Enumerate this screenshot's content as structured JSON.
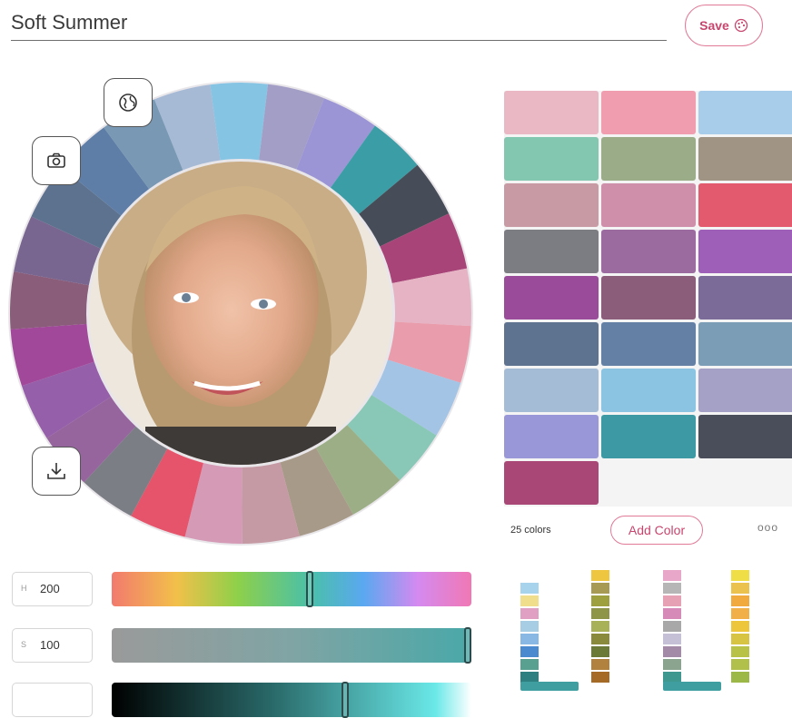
{
  "header": {
    "palette_name": "Soft Summer",
    "save_label": "Save"
  },
  "wheel": {
    "icons": [
      "globe-icon",
      "camera-icon",
      "download-icon"
    ],
    "segment_colors": [
      "#a6bad6",
      "#86c4e4",
      "#a39ec6",
      "#9b95d6",
      "#3b9ea6",
      "#474d58",
      "#a94478",
      "#e6b3c4",
      "#e99cac",
      "#a3c4e4",
      "#89c7b6",
      "#9cae86",
      "#a79a88",
      "#c69aa4",
      "#d49ab6",
      "#e5546a",
      "#7b7e84",
      "#96659e",
      "#965fa9",
      "#a1489a",
      "#8a5d7a",
      "#786690",
      "#5d728e",
      "#5e7ea7",
      "#7898b4"
    ]
  },
  "palette": {
    "swatches": [
      "#e9b8c4",
      "#ef9daf",
      "#a7cdea",
      "#83c7b1",
      "#9aad88",
      "#a09484",
      "#c89aa3",
      "#cf8ea9",
      "#e35a6e",
      "#7b7d83",
      "#9b6b9f",
      "#9d5fb8",
      "#9a4c9b",
      "#8b5d7a",
      "#7a6b98",
      "#5e738f",
      "#6481a5",
      "#7b9db6",
      "#a5bcd7",
      "#8ac4e2",
      "#a5a0c6",
      "#9a97d8",
      "#3d9aa5",
      "#4a4e5a",
      "#a94777"
    ],
    "count_label": "25 colors",
    "add_label": "Add Color",
    "more_label": "ooo"
  },
  "hsv": {
    "hue": {
      "letter": "H",
      "value": "200",
      "position": 0.55
    },
    "saturation": {
      "letter": "S",
      "value": "100",
      "position": 1.0
    },
    "value": {
      "position": 0.65
    }
  },
  "ladders": [
    [
      "#ffffff",
      "#a7d4ec",
      "#f0de8c",
      "#e0a0c4",
      "#a6cde4",
      "#8ab8e4",
      "#4c8ad0",
      "#5aa090",
      "#2e8080"
    ],
    [
      "#eec640",
      "#a69a54",
      "#9ea040",
      "#8e9448",
      "#a8b058",
      "#8a8a3c",
      "#6c7a38",
      "#b0823e",
      "#a46a26"
    ],
    [
      "#e8a6c8",
      "#b6b6b6",
      "#e6a2b4",
      "#d58ab8",
      "#a8a8a8",
      "#c6c0d6",
      "#a38aa6",
      "#8aa490",
      "#3e9890"
    ],
    [
      "#f0de46",
      "#ecc24e",
      "#f0aa3e",
      "#f2b048",
      "#eec63c",
      "#d6c442",
      "#b8c246",
      "#b0c04a",
      "#9cb846"
    ]
  ]
}
